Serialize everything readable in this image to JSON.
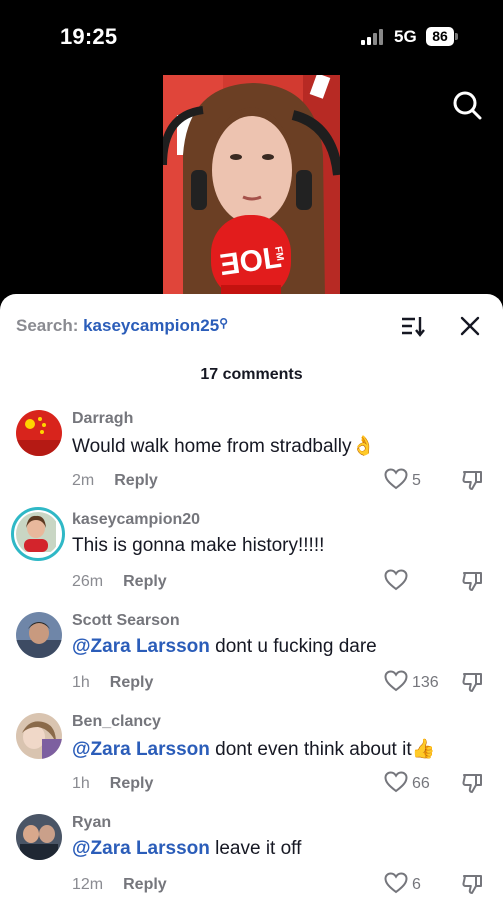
{
  "status_bar": {
    "time": "19:25",
    "network": "5G",
    "battery": "86"
  },
  "video": {
    "mic_brand": "FM"
  },
  "panel": {
    "search_label": "Search: ",
    "search_term": "kaseycampion25",
    "comment_count": "17 comments"
  },
  "comments": [
    {
      "username": "Darragh",
      "text": "Would walk home from stradbally",
      "emoji": "👌",
      "time": "2m",
      "reply": "Reply",
      "likes": "5"
    },
    {
      "username": "kaseycampion20",
      "text": "This is gonna make history!!!!!",
      "time": "26m",
      "reply": "Reply",
      "likes": ""
    },
    {
      "username": "Scott Searson",
      "mention": "@Zara Larsson",
      "text": " dont u fucking dare",
      "time": "1h",
      "reply": "Reply",
      "likes": "136"
    },
    {
      "username": "Ben_clancy",
      "mention": "@Zara Larsson",
      "text": " dont even think about it",
      "emoji": "👍",
      "time": "1h",
      "reply": "Reply",
      "likes": "66"
    },
    {
      "username": "Ryan",
      "mention": "@Zara Larsson",
      "text": " leave it off",
      "time": "12m",
      "reply": "Reply",
      "likes": "6"
    }
  ]
}
